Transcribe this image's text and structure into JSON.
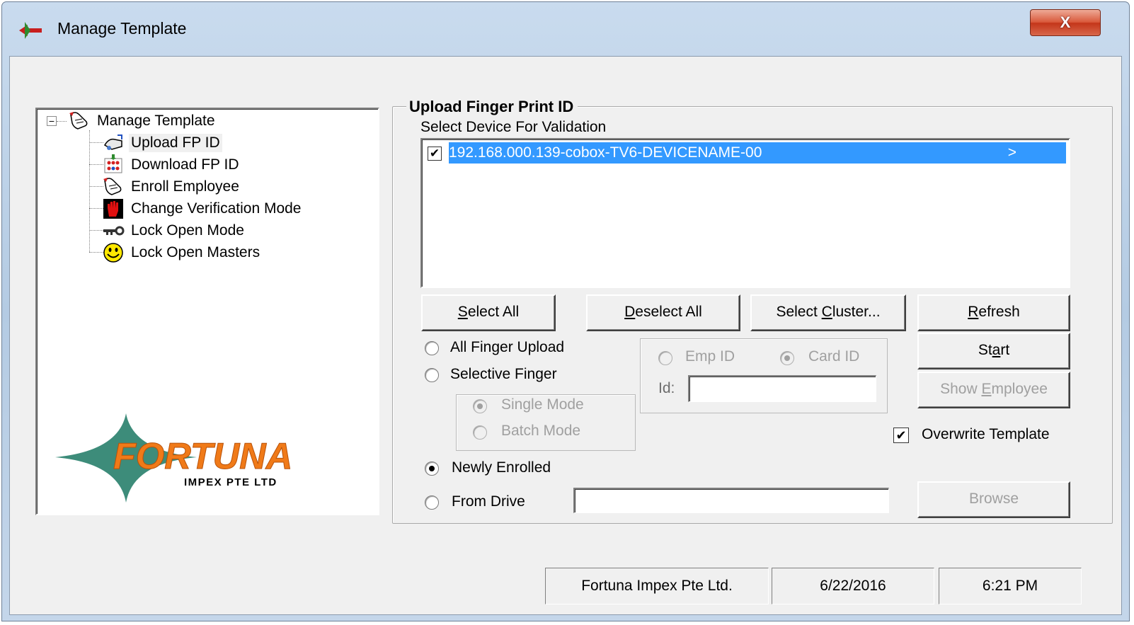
{
  "window": {
    "title": "Manage Template",
    "close_glyph": "X"
  },
  "tree": {
    "root": {
      "label": "Manage Template",
      "expander": "−",
      "icon": "hand-touch-icon"
    },
    "children": [
      {
        "label": "Upload FP ID",
        "icon": "upload-hand-icon"
      },
      {
        "label": "Download FP ID",
        "icon": "download-grid-icon"
      },
      {
        "label": "Enroll Employee",
        "icon": "hand-touch-icon"
      },
      {
        "label": "Change Verification Mode",
        "icon": "red-hand-icon"
      },
      {
        "label": "Lock Open Mode",
        "icon": "key-icon"
      },
      {
        "label": "Lock Open Masters",
        "icon": "smiley-icon"
      }
    ]
  },
  "logo": {
    "name": "FORTUNA",
    "tagline": "IMPEX PTE LTD",
    "star_color": "#3d8c7a",
    "text_color": "#f07a18"
  },
  "upload": {
    "group_title": "Upload Finger Print ID",
    "device_label": "Select Device For Validation",
    "devices": [
      {
        "name": "192.168.000.139-cobox-TV6-DEVICENAME-00",
        "arrow": ">",
        "checked": true,
        "check_glyph": "✔"
      }
    ],
    "buttons": {
      "select_all": {
        "hot": "S",
        "rest": "elect All"
      },
      "deselect_all": {
        "hot": "D",
        "rest": "eselect All"
      },
      "select_cluster": {
        "pre": "Select ",
        "hot": "C",
        "rest": "luster..."
      },
      "refresh": {
        "hot": "R",
        "rest": "efresh"
      },
      "start": {
        "pre": "St",
        "hot": "a",
        "rest": "rt"
      },
      "show_employee": {
        "pre": "Show ",
        "hot": "E",
        "rest": "mployee"
      },
      "browse": "Browse"
    },
    "mode": {
      "all_finger": "All Finger Upload",
      "selective": "Selective Finger",
      "single": "Single Mode",
      "batch": "Batch Mode",
      "newly_enrolled": "Newly Enrolled",
      "from_drive": "From Drive",
      "selected": "newly_enrolled",
      "from_drive_value": ""
    },
    "id_type": {
      "emp_id": "Emp ID",
      "card_id": "Card ID",
      "selected": "card_id",
      "id_label": "Id:",
      "id_value": ""
    },
    "overwrite": {
      "label": "Overwrite Template",
      "checked": true,
      "check_glyph": "✔"
    }
  },
  "status_bar": {
    "company": "Fortuna Impex Pte Ltd.",
    "date": "6/22/2016",
    "time": "6:21 PM"
  }
}
